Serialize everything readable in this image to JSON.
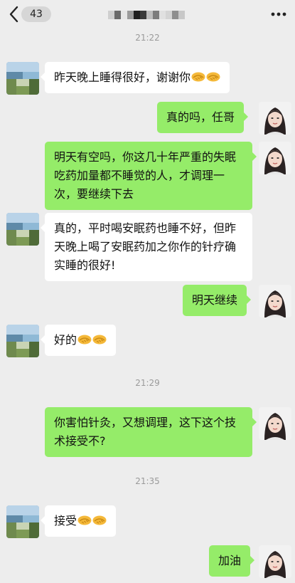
{
  "header": {
    "unread_count": "43",
    "back_icon": "chevron-left-icon",
    "more_icon": "ellipsis-icon",
    "title_mosaic_colors": [
      "#cfcfcf",
      "#6a6a6a",
      "#e5e5e5",
      "#9a9a9a",
      "#1e1e1e",
      "#3a3a3a",
      "#bdbdbd",
      "#7c7c7c",
      "#e0e0e0",
      "#d4d4d4",
      "#8e8e8e",
      "#c8c8c8"
    ]
  },
  "colors": {
    "background": "#ededed",
    "bubble_received": "#ffffff",
    "bubble_sent": "#95ec69",
    "timestamp": "#9a9a9a"
  },
  "timestamps": [
    "21:22",
    "21:29",
    "21:35"
  ],
  "messages": [
    {
      "side": "received",
      "text": "昨天晚上睡得很好，谢谢你",
      "emoji": "handshake-icon",
      "emoji_count": 2
    },
    {
      "side": "sent",
      "text": "真的吗，任哥"
    },
    {
      "side": "sent",
      "text": "明天有空吗，你这几十年严重的失眠吃药加量都不睡觉的人，才调理一次，要继续下去"
    },
    {
      "side": "received",
      "text": "真的，平时喝安眠药也睡不好，但昨天晚上喝了安眠药加之你作的针疗确实睡的很好!"
    },
    {
      "side": "sent",
      "text": "明天继续"
    },
    {
      "side": "received",
      "text": "好的",
      "emoji": "handshake-icon",
      "emoji_count": 2
    },
    {
      "side": "sent",
      "text": "你害怕针灸，又想调理，这下这个技术接受不?"
    },
    {
      "side": "received",
      "text": "接受",
      "emoji": "handshake-icon",
      "emoji_count": 2
    },
    {
      "side": "sent",
      "text": "加油"
    }
  ]
}
